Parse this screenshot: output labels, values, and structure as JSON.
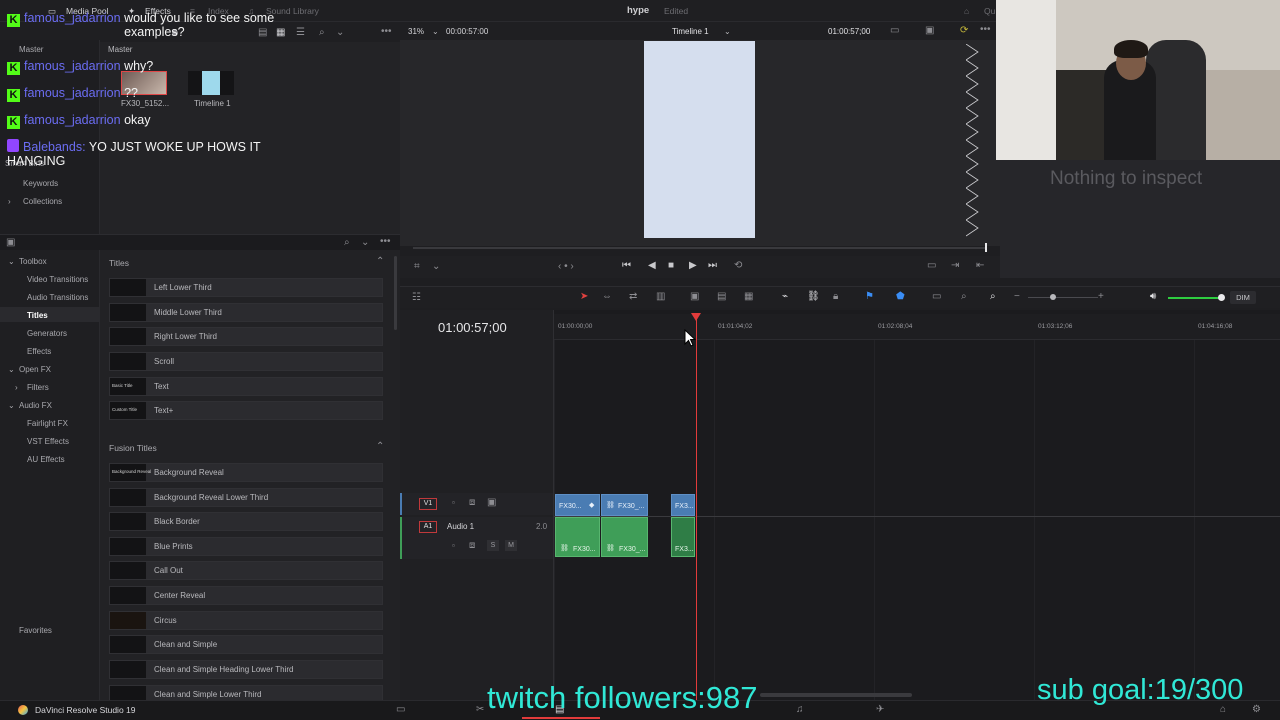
{
  "topbar": {
    "media_pool": "Media Pool",
    "effects": "Effects",
    "index": "Index",
    "sound_library": "Sound Library",
    "project_name": "hype",
    "project_status": "Edited",
    "qu": "Qu"
  },
  "media_pool": {
    "master_label": "Master",
    "master_header": "Master",
    "smart_bins": "Smart Bins",
    "keywords": "Keywords",
    "collections": "Collections",
    "clips": [
      {
        "name": "FX30_5152..."
      },
      {
        "name": "Timeline 1"
      }
    ]
  },
  "viewer": {
    "zoom": "31%",
    "timecode_left": "00:00:57:00",
    "timeline_name": "Timeline 1",
    "timecode_right": "01:00:57;00"
  },
  "inspector": {
    "empty_text": "Nothing to inspect"
  },
  "effects_sidebar": {
    "items": [
      {
        "label": "Toolbox"
      },
      {
        "label": "Video Transitions"
      },
      {
        "label": "Audio Transitions"
      },
      {
        "label": "Titles"
      },
      {
        "label": "Generators"
      },
      {
        "label": "Effects"
      },
      {
        "label": "Open FX"
      },
      {
        "label": "Filters"
      },
      {
        "label": "Audio FX"
      },
      {
        "label": "Fairlight FX"
      },
      {
        "label": "VST Effects"
      },
      {
        "label": "AU Effects"
      }
    ],
    "favorites": "Favorites"
  },
  "effects_list": {
    "titles_section": "Titles",
    "titles": [
      {
        "label": "Left Lower Third",
        "swatch": ""
      },
      {
        "label": "Middle Lower Third",
        "swatch": ""
      },
      {
        "label": "Right Lower Third",
        "swatch": ""
      },
      {
        "label": "Scroll",
        "swatch": ""
      },
      {
        "label": "Text",
        "swatch": "Basic Title"
      },
      {
        "label": "Text+",
        "swatch": "Custom Title"
      }
    ],
    "fusion_section": "Fusion Titles",
    "fusion_titles": [
      {
        "label": "Background Reveal",
        "swatch": "Background Reveal"
      },
      {
        "label": "Background Reveal Lower Third",
        "swatch": ""
      },
      {
        "label": "Black Border",
        "swatch": ""
      },
      {
        "label": "Blue Prints",
        "swatch": ""
      },
      {
        "label": "Call Out",
        "swatch": ""
      },
      {
        "label": "Center Reveal",
        "swatch": ""
      },
      {
        "label": "Circus",
        "swatch": ""
      },
      {
        "label": "Clean and Simple",
        "swatch": ""
      },
      {
        "label": "Clean and Simple Heading Lower Third",
        "swatch": ""
      },
      {
        "label": "Clean and Simple Lower Third",
        "swatch": ""
      }
    ]
  },
  "timeline": {
    "timecode": "01:00:57;00",
    "dim": "DIM",
    "ruler": [
      "01:00:00;00",
      "01:01:04;02",
      "01:02:08;04",
      "01:03:12;06",
      "01:04:16;08"
    ],
    "v1": "V1",
    "a1": "A1",
    "audio_track_name": "Audio 1",
    "audio_channels": "2.0",
    "solo": "S",
    "mute": "M",
    "clips_video": [
      "FX30...",
      "FX30_...",
      "FX3..."
    ],
    "clips_audio": [
      "FX30...",
      "FX30_...",
      "FX3..."
    ]
  },
  "chat": [
    {
      "platform": "kick",
      "user": "famous_jadarrion",
      "message": "would you like to see some examples?"
    },
    {
      "platform": "kick",
      "user": "famous_jadarrion",
      "message": "why?"
    },
    {
      "platform": "kick",
      "user": "famous_jadarrion",
      "message": "??"
    },
    {
      "platform": "kick",
      "user": "famous_jadarrion",
      "message": "okay"
    },
    {
      "platform": "twitch",
      "user": "Balebands",
      "message": "YO JUST WOKE UP HOWS IT HANGING"
    }
  ],
  "stream_overlay": {
    "followers": "twitch followers:987",
    "sub_goal": "sub goal:19/300"
  },
  "bottombar": {
    "app_name": "DaVinci Resolve Studio 19"
  },
  "colors": {
    "accent_red": "#e23b3b",
    "video_clip": "#4a7cb3",
    "audio_clip": "#3f9e58",
    "overlay_cyan": "#30e8d6",
    "chat_name": "#6b6df2"
  }
}
